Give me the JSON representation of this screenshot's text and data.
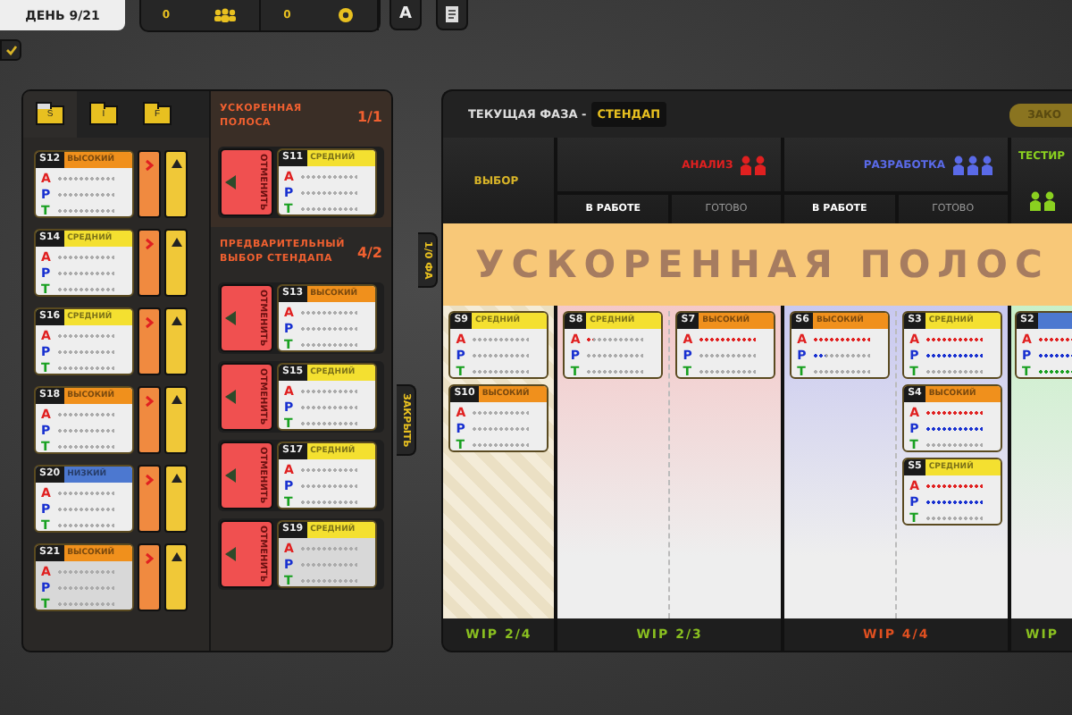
{
  "top_bar": {
    "day": "ДЕНЬ 9/21",
    "counters": [
      {
        "value": "0",
        "kind": "people"
      },
      {
        "value": "0",
        "kind": "coin"
      }
    ],
    "buttons": [
      {
        "kind": "letter",
        "label": "A"
      },
      {
        "kind": "document"
      }
    ]
  },
  "toggle": {
    "checked": true
  },
  "left_panel": {
    "tabs": [
      {
        "label": "S",
        "selected": true
      },
      {
        "label": "I",
        "selected": false
      },
      {
        "label": "F",
        "selected": false
      }
    ],
    "backlog": [
      {
        "id": "S12",
        "color": "#f0901c",
        "label": "ВЫСОКИЙ",
        "stats": [
          {
            "letter": "A",
            "level": 0
          },
          {
            "letter": "P",
            "level": 0
          },
          {
            "letter": "T",
            "level": 0
          }
        ]
      },
      {
        "id": "S14",
        "color": "#f4e030",
        "label": "СРЕДНИЙ",
        "stats": [
          {
            "letter": "A",
            "level": 0
          },
          {
            "letter": "P",
            "level": 0
          },
          {
            "letter": "T",
            "level": 0
          }
        ]
      },
      {
        "id": "S16",
        "color": "#f4e030",
        "label": "СРЕДНИЙ",
        "stats": [
          {
            "letter": "A",
            "level": 0
          },
          {
            "letter": "P",
            "level": 0
          },
          {
            "letter": "T",
            "level": 0
          }
        ]
      },
      {
        "id": "S18",
        "color": "#f0901c",
        "label": "ВЫСОКИЙ",
        "stats": [
          {
            "letter": "A",
            "level": 0
          },
          {
            "letter": "P",
            "level": 0
          },
          {
            "letter": "T",
            "level": 0
          }
        ]
      },
      {
        "id": "S20",
        "color": "#4c78d0",
        "label": "НИЗКИЙ",
        "stats": [
          {
            "letter": "A",
            "level": 0
          },
          {
            "letter": "P",
            "level": 0
          },
          {
            "letter": "T",
            "level": 0
          }
        ]
      },
      {
        "id": "S21",
        "color": "#f0901c",
        "label": "ВЫСОКИЙ",
        "stats": [
          {
            "letter": "A",
            "level": 0
          },
          {
            "letter": "P",
            "level": 0
          },
          {
            "letter": "T",
            "level": 0
          }
        ]
      }
    ],
    "sections": [
      {
        "title": "УСКОРЕННАЯ ПОЛОСА",
        "count": "1/1",
        "kind": "expedite",
        "slots": [
          {
            "cancel": "ОТМЕНИТЬ",
            "card": {
              "id": "S11",
              "color": "#f4e030",
              "label": "СРЕДНИЙ",
              "stats": [
                {
                  "letter": "A",
                  "level": 0
                },
                {
                  "letter": "P",
                  "level": 0
                },
                {
                  "letter": "T",
                  "level": 0
                }
              ]
            }
          }
        ]
      },
      {
        "title": "ПРЕДВАРИТЕЛЬНЫЙ ВЫБОР СТЕНДАПА",
        "count": "4/2",
        "kind": "standup",
        "slots": [
          {
            "cancel": "ОТМЕНИТЬ",
            "card": {
              "id": "S13",
              "color": "#f0901c",
              "label": "ВЫСОКИЙ",
              "stats": [
                {
                  "letter": "A",
                  "level": 0
                },
                {
                  "letter": "P",
                  "level": 0
                },
                {
                  "letter": "T",
                  "level": 0
                }
              ]
            }
          },
          {
            "cancel": "ОТМЕНИТЬ",
            "card": {
              "id": "S15",
              "color": "#f4e030",
              "label": "СРЕДНИЙ",
              "stats": [
                {
                  "letter": "A",
                  "level": 0
                },
                {
                  "letter": "P",
                  "level": 0
                },
                {
                  "letter": "T",
                  "level": 0
                }
              ]
            }
          },
          {
            "cancel": "ОТМЕНИТЬ",
            "card": {
              "id": "S17",
              "color": "#f4e030",
              "label": "СРЕДНИЙ",
              "stats": [
                {
                  "letter": "A",
                  "level": 0
                },
                {
                  "letter": "P",
                  "level": 0
                },
                {
                  "letter": "T",
                  "level": 0
                }
              ]
            }
          },
          {
            "cancel": "ОТМЕНИТЬ",
            "card": {
              "id": "S19",
              "color": "#f4e030",
              "label": "СРЕДНИЙ",
              "stats": [
                {
                  "letter": "A",
                  "level": 0
                },
                {
                  "letter": "P",
                  "level": 0
                },
                {
                  "letter": "T",
                  "level": 0
                }
              ]
            }
          }
        ]
      }
    ]
  },
  "side_tabs": [
    {
      "label": "1/0 ФА"
    },
    {
      "label": "ЗАКРЫТЬ"
    }
  ],
  "board": {
    "phase_label": "ТЕКУЩАЯ ФАЗА -",
    "phase": "СТЕНДАП",
    "action_button": "ЗАКО",
    "banner": "УСКОРЕННАЯ ПОЛОС",
    "columns": [
      {
        "title": "ВЫБОР",
        "color": "#d8b428",
        "kind": "select",
        "wip": "WIP 2/4",
        "wip_over": false,
        "lanes": [
          {
            "cards": [
              {
                "id": "S9",
                "color": "#f4e030",
                "label": "СРЕДНИЙ",
                "stats": [
                  {
                    "letter": "A",
                    "level": 0
                  },
                  {
                    "letter": "P",
                    "level": 0
                  },
                  {
                    "letter": "T",
                    "level": 0
                  }
                ]
              },
              {
                "id": "S10",
                "color": "#f0901c",
                "label": "ВЫСОКИЙ",
                "stats": [
                  {
                    "letter": "A",
                    "level": 0
                  },
                  {
                    "letter": "P",
                    "level": 0
                  },
                  {
                    "letter": "T",
                    "level": 0
                  }
                ]
              }
            ]
          }
        ]
      },
      {
        "title": "АНАЛИЗ",
        "color": "#e02020",
        "kind": "stage",
        "wip": "WIP 2/3",
        "wip_over": false,
        "workers": [
          {
            "color": "#e02020"
          },
          {
            "color": "#e02020"
          }
        ],
        "lanes": [
          {
            "label": "В РАБОТЕ",
            "kind": "doing",
            "cards": [
              {
                "id": "S8",
                "color": "#f4e030",
                "label": "СРЕДНИЙ",
                "stats": [
                  {
                    "letter": "A",
                    "level": 0.12
                  },
                  {
                    "letter": "P",
                    "level": 0
                  },
                  {
                    "letter": "T",
                    "level": 0
                  }
                ]
              }
            ]
          },
          {
            "label": "ГОТОВО",
            "kind": "done",
            "cards": [
              {
                "id": "S7",
                "color": "#f0901c",
                "label": "ВЫСОКИЙ",
                "stats": [
                  {
                    "letter": "A",
                    "level": 1
                  },
                  {
                    "letter": "P",
                    "level": 0
                  },
                  {
                    "letter": "T",
                    "level": 0
                  }
                ]
              }
            ]
          }
        ]
      },
      {
        "title": "РАЗРАБОТКА",
        "color": "#5a6ae8",
        "kind": "stage",
        "wip": "WIP 4/4",
        "wip_over": true,
        "workers": [
          {
            "color": "#5a6ae8"
          },
          {
            "color": "#5a6ae8"
          },
          {
            "color": "#5a6ae8"
          }
        ],
        "lanes": [
          {
            "label": "В РАБОТЕ",
            "kind": "doing",
            "cards": [
              {
                "id": "S6",
                "color": "#f0901c",
                "label": "ВЫСОКИЙ",
                "stats": [
                  {
                    "letter": "A",
                    "level": 1
                  },
                  {
                    "letter": "P",
                    "level": 0.2
                  },
                  {
                    "letter": "T",
                    "level": 0
                  }
                ]
              }
            ]
          },
          {
            "label": "ГОТОВО",
            "kind": "done",
            "cards": [
              {
                "id": "S3",
                "color": "#f4e030",
                "label": "СРЕДНИЙ",
                "stats": [
                  {
                    "letter": "A",
                    "level": 1
                  },
                  {
                    "letter": "P",
                    "level": 1
                  },
                  {
                    "letter": "T",
                    "level": 0
                  }
                ]
              },
              {
                "id": "S4",
                "color": "#f0901c",
                "label": "ВЫСОКИЙ",
                "stats": [
                  {
                    "letter": "A",
                    "level": 1
                  },
                  {
                    "letter": "P",
                    "level": 1
                  },
                  {
                    "letter": "T",
                    "level": 0
                  }
                ]
              },
              {
                "id": "S5",
                "color": "#f4e030",
                "label": "СРЕДНИЙ",
                "stats": [
                  {
                    "letter": "A",
                    "level": 1
                  },
                  {
                    "letter": "P",
                    "level": 1
                  },
                  {
                    "letter": "T",
                    "level": 0
                  }
                ]
              }
            ]
          }
        ]
      },
      {
        "title": "ТЕСТИР",
        "color": "#8ad020",
        "kind": "cut",
        "wip": "WIP",
        "wip_over": false,
        "workers": [
          {
            "color": "#8ad020"
          },
          {
            "color": "#8ad020"
          }
        ],
        "lanes": [
          {
            "cards": [
              {
                "id": "S2",
                "color": "#4c78d0",
                "stats": [
                  {
                    "letter": "A",
                    "level": 1
                  },
                  {
                    "letter": "P",
                    "level": 1
                  },
                  {
                    "letter": "T",
                    "level": 1
                  }
                ]
              }
            ]
          }
        ]
      }
    ]
  }
}
